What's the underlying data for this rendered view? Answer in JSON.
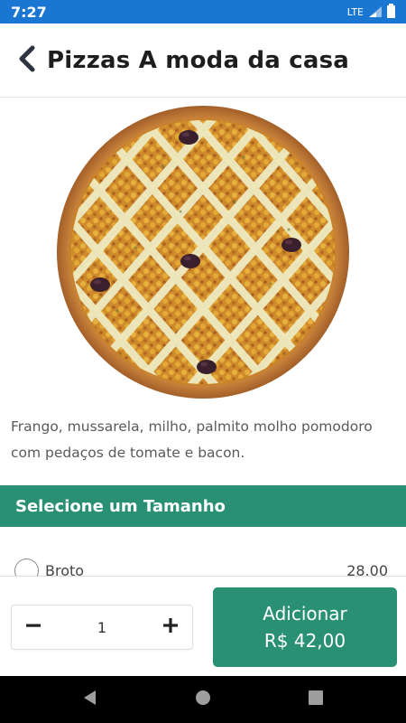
{
  "status_bar": {
    "time": "7:27",
    "network": "LTE"
  },
  "header": {
    "title": "Pizzas A moda da casa",
    "back_icon": "chevron-left-icon"
  },
  "product": {
    "image_alt": "pizza",
    "description": "Frango, mussarela, milho, palmito molho pomodoro com pedaços de tomate e bacon."
  },
  "size_section": {
    "title": "Selecione um Tamanho",
    "options": [
      {
        "label": "Broto",
        "price": "28.00",
        "selected": false
      }
    ]
  },
  "cart": {
    "quantity": "1",
    "minus_icon": "minus-icon",
    "plus_icon": "plus-icon",
    "add_label": "Adicionar",
    "add_price": "R$ 42,00"
  },
  "colors": {
    "status_bar": "#1976d2",
    "accent": "#2a9074"
  }
}
